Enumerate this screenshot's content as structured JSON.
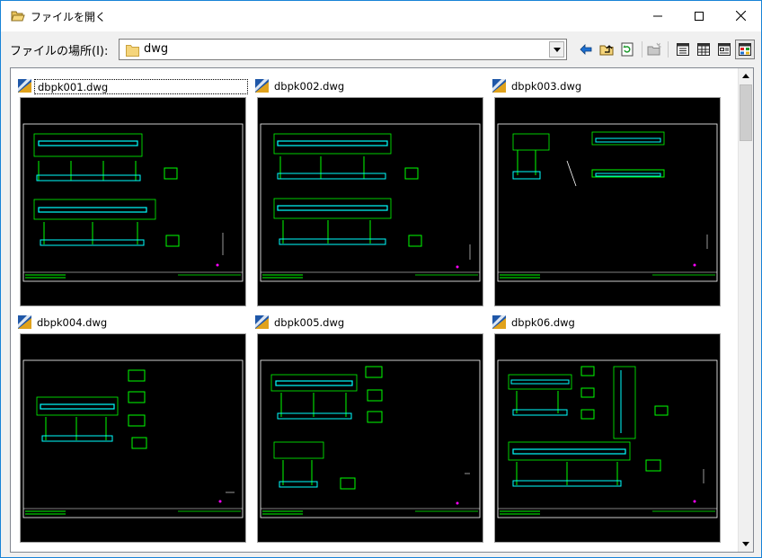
{
  "window": {
    "title": "ファイルを開く",
    "minimize_glyph": "—",
    "maximize_glyph": "☐",
    "close_glyph": "✕"
  },
  "location": {
    "label": "ファイルの場所(I):",
    "value": "dwg"
  },
  "toolbar": {
    "icons": [
      "back-icon",
      "up-folder-icon",
      "refresh-icon",
      "new-folder-icon",
      "view-list-icon",
      "view-details-icon",
      "view-large-icon",
      "view-thumbnails-icon"
    ]
  },
  "files": [
    {
      "name": "dbpk001.dwg"
    },
    {
      "name": "dbpk002.dwg"
    },
    {
      "name": "dbpk003.dwg"
    },
    {
      "name": "dbpk004.dwg"
    },
    {
      "name": "dbpk005.dwg"
    },
    {
      "name": "dbpk06.dwg"
    }
  ],
  "colors": {
    "accent": "#1883d7",
    "cad_background": "#000000",
    "cad_green": "#00ff00",
    "cad_cyan": "#00ffff",
    "cad_white": "#ffffff",
    "cad_magenta": "#ff00ff"
  }
}
